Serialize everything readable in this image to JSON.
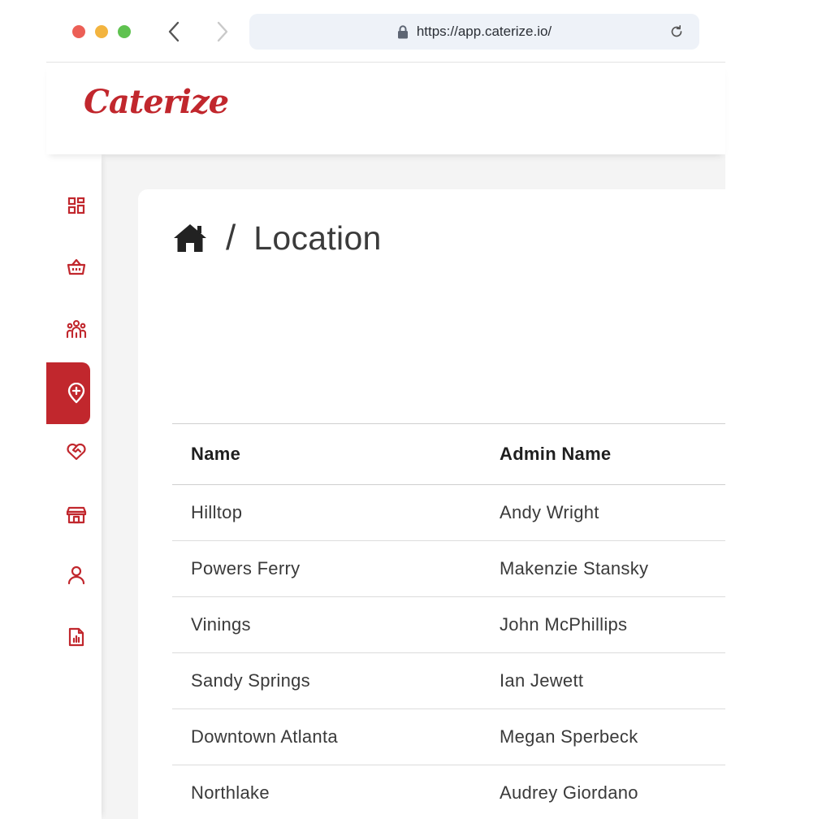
{
  "browser": {
    "url": "https://app.caterize.io/",
    "colors": {
      "close": "#ec5f56",
      "minimize": "#f3b43f",
      "maximize": "#5fc250",
      "urlbar": "#eef2f8"
    }
  },
  "header": {
    "logo": "Caterize",
    "brand_color": "#c1272d"
  },
  "sidebar": {
    "accent": "#c1272d",
    "items": [
      {
        "icon": "dashboard-icon",
        "active": false
      },
      {
        "icon": "basket-icon",
        "active": false
      },
      {
        "icon": "people-icon",
        "active": false
      },
      {
        "icon": "location-pin-icon",
        "active": true
      },
      {
        "icon": "heart-handshake-icon",
        "active": false
      },
      {
        "icon": "storefront-icon",
        "active": false
      },
      {
        "icon": "user-icon",
        "active": false
      },
      {
        "icon": "report-icon",
        "active": false
      }
    ]
  },
  "breadcrumb": {
    "home_icon": "home-icon",
    "separator": "/",
    "title": "Location"
  },
  "table": {
    "columns": [
      "Name",
      "Admin Name"
    ],
    "rows": [
      [
        "Hilltop",
        "Andy Wright"
      ],
      [
        "Powers Ferry",
        "Makenzie Stansky"
      ],
      [
        "Vinings",
        "John McPhillips"
      ],
      [
        "Sandy Springs",
        "Ian Jewett"
      ],
      [
        "Downtown Atlanta",
        "Megan Sperbeck"
      ],
      [
        "Northlake",
        "Audrey Giordano"
      ]
    ]
  }
}
